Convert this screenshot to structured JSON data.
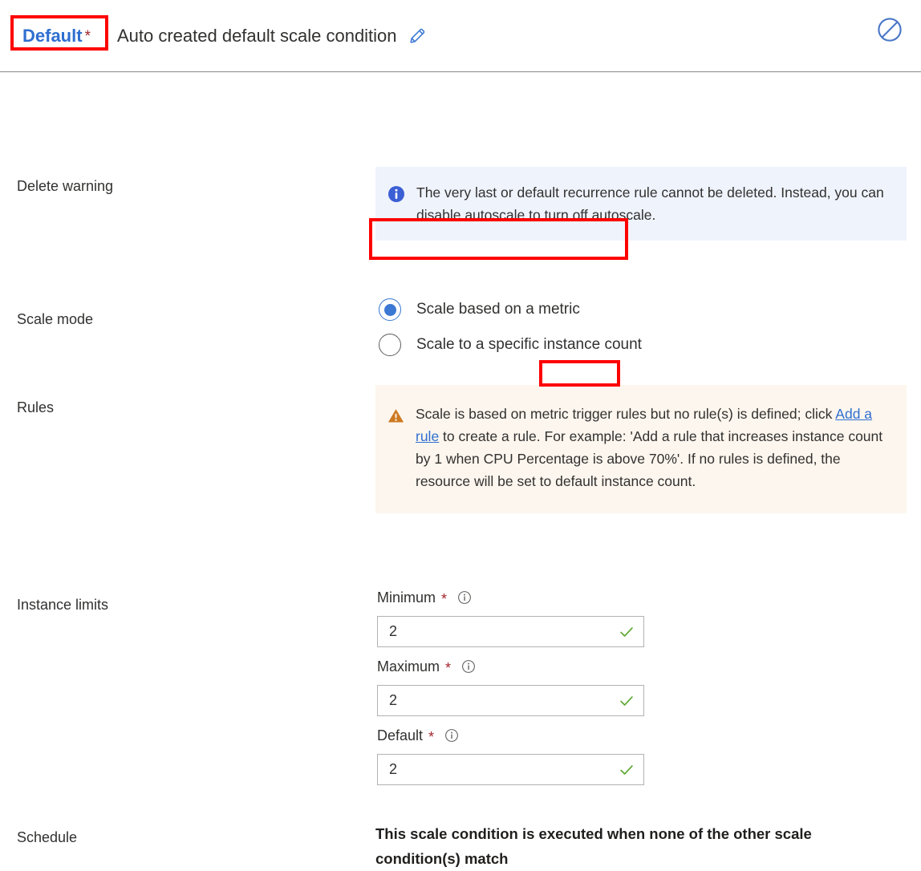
{
  "header": {
    "condition_name": "Default",
    "required_marker": "*",
    "condition_description": "Auto created default scale condition",
    "edit_icon": "pencil-edit-icon",
    "disable_icon": "no-entry-disable-icon"
  },
  "rows": {
    "delete_warning": {
      "label": "Delete warning",
      "icon": "info-circle-icon",
      "message": "The very last or default recurrence rule cannot be deleted. Instead, you can disable autoscale to turn off autoscale."
    },
    "scale_mode": {
      "label": "Scale mode",
      "options": [
        {
          "label": "Scale based on a metric",
          "selected": true
        },
        {
          "label": "Scale to a specific instance count",
          "selected": false
        }
      ]
    },
    "rules": {
      "label": "Rules",
      "icon": "warning-triangle-icon",
      "message_part1": "Scale is based on metric trigger rules but no rule(s) is defined; click ",
      "link_text": "Add a rule",
      "message_part2": " to create a rule. For example: 'Add a rule that increases instance count by 1 when CPU Percentage is above 70%'. If no rules is defined, the resource will be set to default instance count."
    },
    "instance_limits": {
      "label": "Instance limits",
      "fields": [
        {
          "label": "Minimum",
          "required": "*",
          "value": "2",
          "valid": true,
          "info_icon": "info-outline-icon"
        },
        {
          "label": "Maximum",
          "required": "*",
          "value": "2",
          "valid": true,
          "info_icon": "info-outline-icon"
        },
        {
          "label": "Default",
          "required": "*",
          "value": "2",
          "valid": true,
          "info_icon": "info-outline-icon"
        }
      ]
    },
    "schedule": {
      "label": "Schedule",
      "text": "This scale condition is executed when none of the other scale condition(s) match"
    }
  },
  "colors": {
    "link_blue": "#2f6fd0",
    "accent_blue": "#3b78d4",
    "info_bg": "#eff3fc",
    "info_icon": "#3b5fd4",
    "warning_bg": "#fdf6ee",
    "warning_icon": "#cc7a22",
    "required_red": "#a4262c",
    "valid_green": "#5fa832",
    "annotation_red": "#ff0000"
  }
}
